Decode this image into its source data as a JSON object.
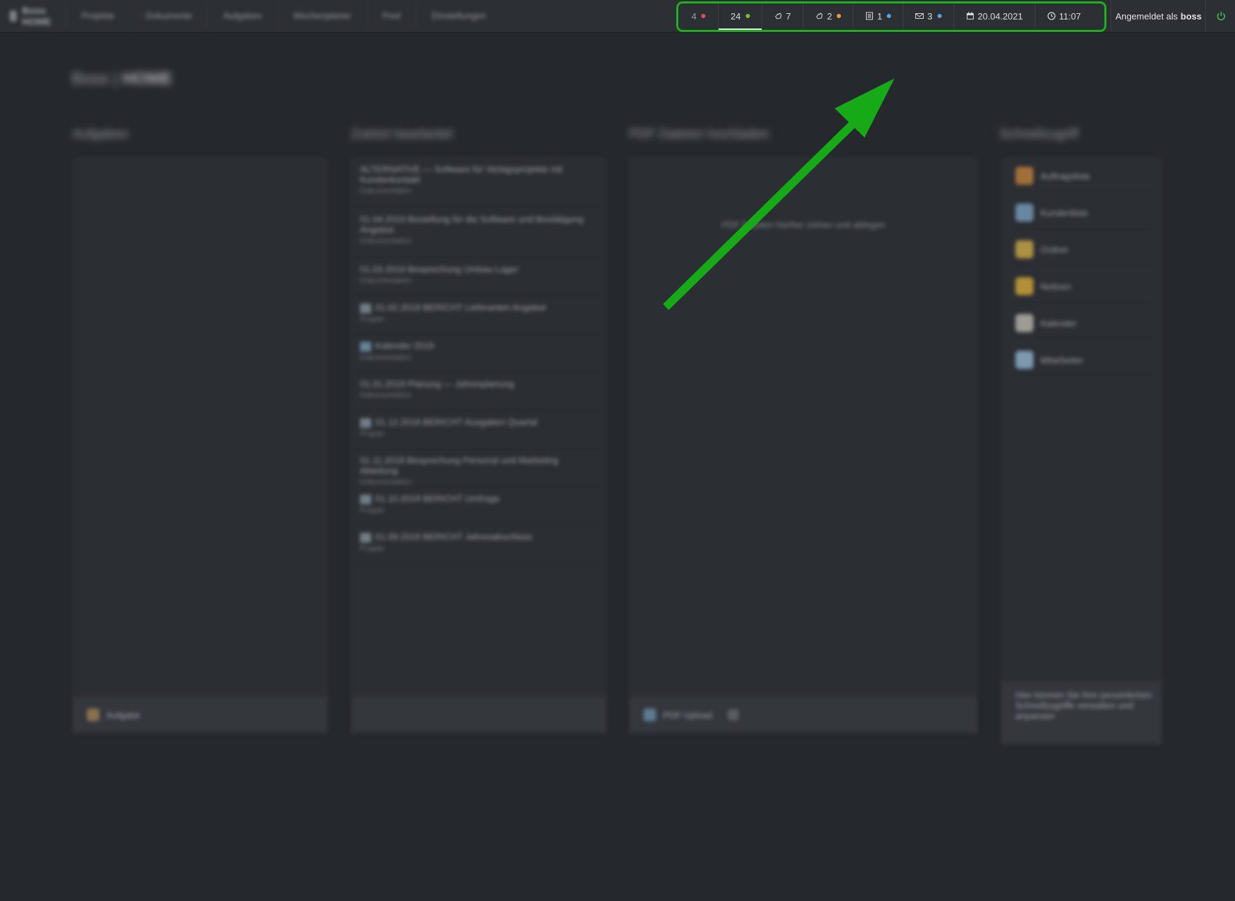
{
  "topbar": {
    "brand": "Boss HOME",
    "nav": [
      "Projekte",
      "Dokumente",
      "Aufgaben",
      "Wochenplaner",
      "Pool",
      "Einstellungen"
    ],
    "status": [
      {
        "label": "4",
        "dot": "#e05252"
      },
      {
        "label": "24",
        "dot": "#7cc22a",
        "active": true
      },
      {
        "label": "7",
        "icon": "hand-icon"
      },
      {
        "label": "2",
        "icon": "hand-icon",
        "dot": "#f0993a"
      },
      {
        "label": "1",
        "icon": "list-icon",
        "dot": "#4da7e6"
      },
      {
        "label": "3",
        "icon": "envelope-icon",
        "dot": "#4da7e6"
      },
      {
        "label": "20.04.2021",
        "icon": "calendar-icon"
      },
      {
        "label": "11:07",
        "icon": "clock-icon"
      }
    ],
    "login_prefix": "Angemeldet als",
    "login_user": "boss",
    "highlight_color": "#1bb21b",
    "power_color": "#47b347"
  },
  "page": {
    "title_prefix": "Boss |",
    "title_main": "HOME"
  },
  "columns": {
    "tasks": {
      "heading": "Aufgaben",
      "footer": "Aufgabe"
    },
    "recent": {
      "heading": "Zuletzt bearbeitet",
      "items": [
        {
          "title": "ALTERNATIVE — Software für Verlagsprojekte mit Kundenkontakt",
          "sub": "Dokumentation"
        },
        {
          "title": "01.04.2019 Bestellung für die Software und Bestätigung Angebot",
          "sub": "Dokumentation"
        },
        {
          "title": "01.03.2019 Besprechung Umbau Lager",
          "sub": "Dokumentation"
        },
        {
          "title": "01.02.2019 BERICHT Lieferanten Angebot",
          "sub": "Projekt"
        },
        {
          "title": "Kalender 2019",
          "sub": "Dokumentation"
        },
        {
          "title": "01.01.2019 Planung — Jahresplanung",
          "sub": "Dokumentation"
        },
        {
          "title": "01.12.2018 BERICHT Ausgaben Quartal",
          "sub": "Projekt"
        },
        {
          "title": "01.11.2018 Besprechung Personal und Marketing Abteilung",
          "sub": "Dokumentation"
        },
        {
          "title": "01.10.2018 BERICHT Umfrage",
          "sub": "Projekt"
        },
        {
          "title": "01.09.2018 BERICHT Jahresabschluss",
          "sub": "Projekt"
        }
      ]
    },
    "pdf": {
      "heading": "PDF Dateien hochladen",
      "empty_text": "PDF Dateien hierher ziehen und ablegen",
      "footer": "PDF Upload"
    },
    "shortcuts": {
      "heading": "Schnellzugriff",
      "items": [
        {
          "label": "Auftragsliste",
          "color": "#c9883d"
        },
        {
          "label": "Kundenliste",
          "color": "#7fa8c8"
        },
        {
          "label": "Ordner",
          "color": "#d9b54a"
        },
        {
          "label": "Notizen",
          "color": "#e0b43a"
        },
        {
          "label": "Kalender",
          "color": "#c7c2b8"
        },
        {
          "label": "Mitarbeiter",
          "color": "#9bbfd9"
        }
      ],
      "footer": "Hier können Sie Ihre persönlichen Schnellzugriffe verwalten und anpassen"
    }
  }
}
